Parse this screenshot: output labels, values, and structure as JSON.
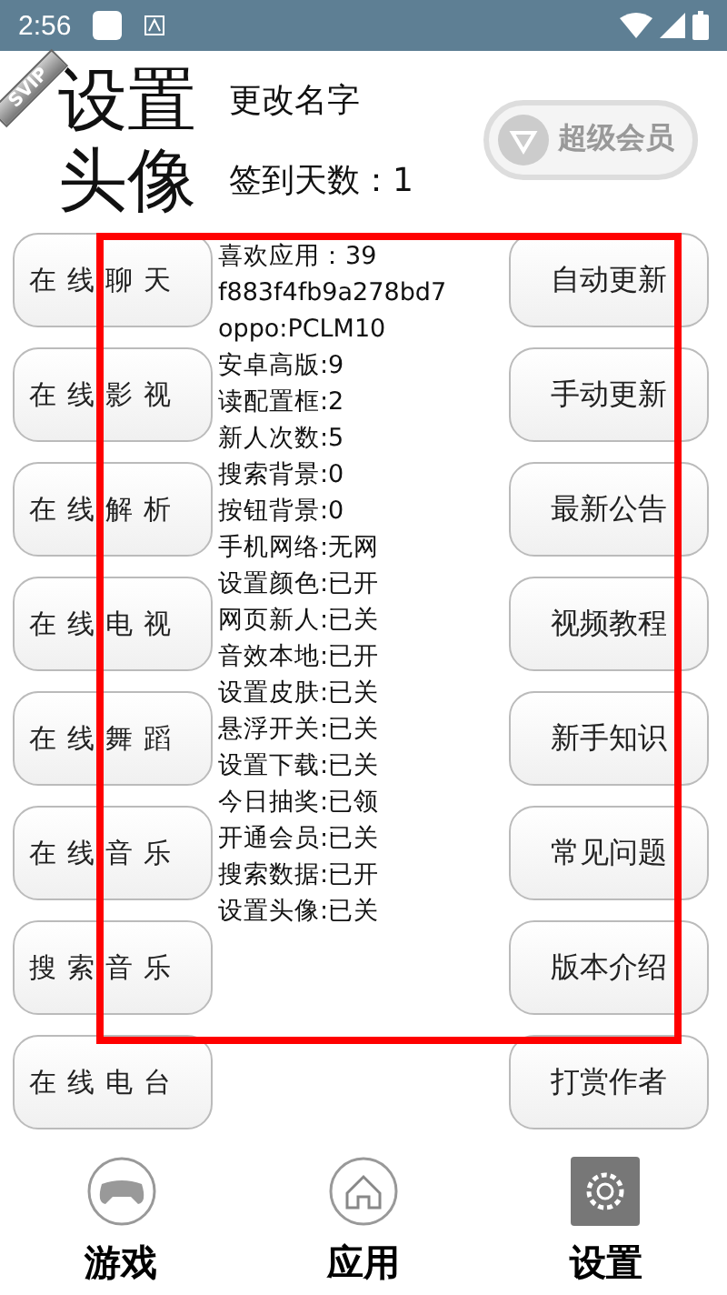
{
  "status_bar": {
    "time": "2:56"
  },
  "header": {
    "title_lines": [
      "设置",
      "头像"
    ],
    "badge": "SVIP",
    "rename": "更改名字",
    "checkin": "签到天数：1",
    "vip_label": "超级会员"
  },
  "left_buttons": [
    "在线聊天",
    "在线影视",
    "在线解析",
    "在线电视",
    "在线舞蹈",
    "在线音乐",
    "搜索音乐",
    "在线电台"
  ],
  "info_lines": [
    "喜欢应用：39",
    "f883f4fb9a278bd7",
    "oppo:PCLM10",
    "安卓高版:9",
    "读配置框:2",
    "新人次数:5",
    "搜索背景:0",
    "按钮背景:0",
    "手机网络:无网",
    "设置颜色:已开",
    "网页新人:已关",
    "音效本地:已开",
    "设置皮肤:已关",
    "悬浮开关:已关",
    "设置下载:已关",
    "今日抽奖:已领",
    "开通会员:已关",
    "搜索数据:已开",
    "设置头像:已关"
  ],
  "right_buttons": [
    "自动更新",
    "手动更新",
    "最新公告",
    "视频教程",
    "新手知识",
    "常见问题",
    "版本介绍",
    "打赏作者"
  ],
  "bottom_nav": [
    {
      "label": "游戏",
      "kind": "gamepad",
      "selected": false
    },
    {
      "label": "应用",
      "kind": "home",
      "selected": false
    },
    {
      "label": "设置",
      "kind": "gear",
      "selected": true
    }
  ]
}
